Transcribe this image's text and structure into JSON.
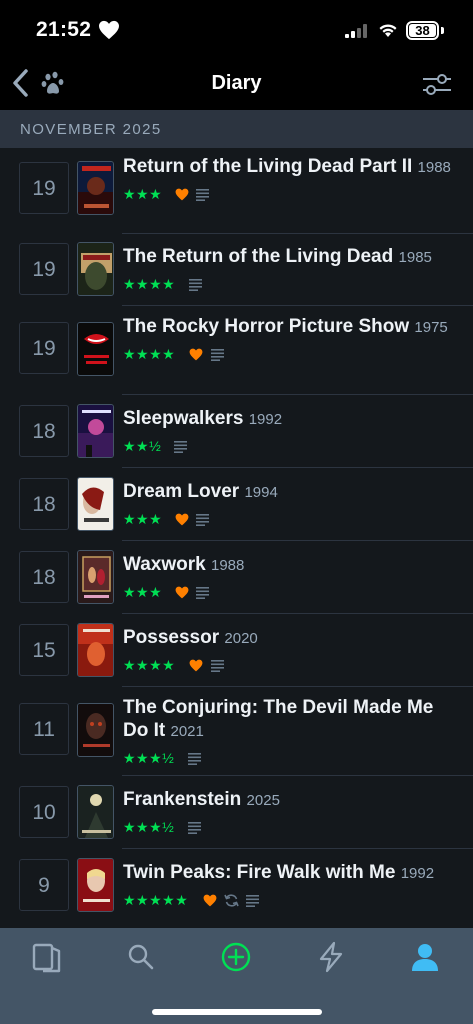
{
  "status_bar": {
    "time": "21:52",
    "battery": "38"
  },
  "nav": {
    "title": "Diary",
    "icons": [
      "back-chevron-icon",
      "paw-icon",
      "filter-sliders-icon"
    ]
  },
  "section": {
    "label": "NOVEMBER 2025"
  },
  "colors": {
    "green_stars": "#00e054",
    "like_orange": "#ff8000",
    "header_bg": "#2c3440",
    "tab_bar_bg": "#445566",
    "active_tab": "#40bcf4"
  },
  "entries": [
    {
      "day": "19",
      "title": "Return of the Living Dead Part II",
      "year": "1988",
      "stars": "★★★",
      "liked": true,
      "rewatch": false,
      "review": true
    },
    {
      "day": "19",
      "title": "The Return of the Living Dead",
      "year": "1985",
      "stars": "★★★★",
      "liked": false,
      "rewatch": false,
      "review": true
    },
    {
      "day": "19",
      "title": "The Rocky Horror Picture Show",
      "year": "1975",
      "stars": "★★★★",
      "liked": true,
      "rewatch": false,
      "review": true
    },
    {
      "day": "18",
      "title": "Sleepwalkers",
      "year": "1992",
      "stars": "★★½",
      "liked": false,
      "rewatch": false,
      "review": true
    },
    {
      "day": "18",
      "title": "Dream Lover",
      "year": "1994",
      "stars": "★★★",
      "liked": true,
      "rewatch": false,
      "review": true
    },
    {
      "day": "18",
      "title": "Waxwork",
      "year": "1988",
      "stars": "★★★",
      "liked": true,
      "rewatch": false,
      "review": true
    },
    {
      "day": "15",
      "title": "Possessor",
      "year": "2020",
      "stars": "★★★★",
      "liked": true,
      "rewatch": false,
      "review": true
    },
    {
      "day": "11",
      "title": "The Conjuring: The Devil Made Me Do It",
      "year": "2021",
      "stars": "★★★½",
      "liked": false,
      "rewatch": false,
      "review": true
    },
    {
      "day": "10",
      "title": "Frankenstein",
      "year": "2025",
      "stars": "★★★½",
      "liked": false,
      "rewatch": false,
      "review": true
    },
    {
      "day": "9",
      "title": "Twin Peaks: Fire Walk with Me",
      "year": "1992",
      "stars": "★★★★★",
      "liked": true,
      "rewatch": true,
      "review": true
    }
  ],
  "tabs": [
    {
      "name": "films-tab",
      "icon": "book-icon",
      "active": false
    },
    {
      "name": "search-tab",
      "icon": "search-icon",
      "active": false
    },
    {
      "name": "log-tab",
      "icon": "plus-circle-icon",
      "active": false
    },
    {
      "name": "activity-tab",
      "icon": "lightning-icon",
      "active": false
    },
    {
      "name": "profile-tab",
      "icon": "person-icon",
      "active": true
    }
  ]
}
